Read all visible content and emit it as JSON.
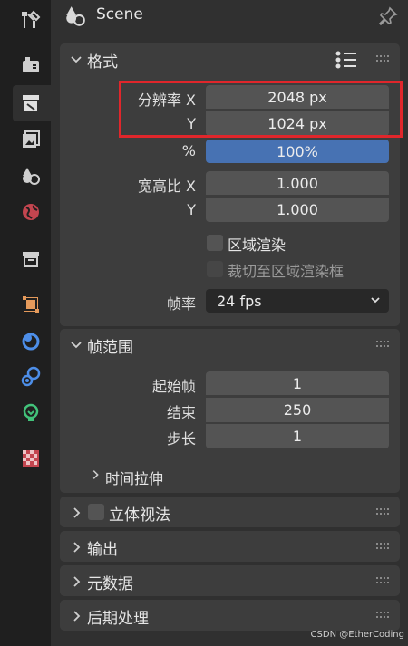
{
  "header": {
    "title": "Scene",
    "icon": "scene-icon",
    "pin_icon": "pin-icon"
  },
  "sidebar": {
    "tabs": [
      {
        "name": "tool-icon"
      },
      {
        "name": "render-icon"
      },
      {
        "name": "output-icon",
        "active": true
      },
      {
        "name": "view-layer-icon"
      },
      {
        "name": "scene-icon"
      },
      {
        "name": "world-icon"
      },
      {
        "name": "collection-icon"
      },
      {
        "name": "object-icon"
      },
      {
        "name": "modifier-icon"
      },
      {
        "name": "physics-icon"
      },
      {
        "name": "object-data-icon"
      },
      {
        "name": "texture-icon"
      }
    ]
  },
  "format_panel": {
    "title": "格式",
    "resolution_x_label": "分辨率 X",
    "resolution_y_label": "Y",
    "resolution_x": "2048 px",
    "resolution_y": "1024 px",
    "percent_label": "%",
    "percent_value": "100%",
    "percent_fraction": 1.0,
    "aspect_x_label": "宽高比 X",
    "aspect_y_label": "Y",
    "aspect_x": "1.000",
    "aspect_y": "1.000",
    "render_region_label": "区域渲染",
    "crop_region_label": "裁切至区域渲染框",
    "frame_rate_label": "帧率",
    "frame_rate_value": "24 fps"
  },
  "frame_range_panel": {
    "title": "帧范围",
    "start_label": "起始帧",
    "start_value": "1",
    "end_label": "结束",
    "end_value": "250",
    "step_label": "步长",
    "step_value": "1",
    "time_stretch_label": "时间拉伸"
  },
  "stereoscopy_panel": {
    "title": "立体视法"
  },
  "output_panel": {
    "title": "输出"
  },
  "metadata_panel": {
    "title": "元数据"
  },
  "post_panel": {
    "title": "后期处理"
  },
  "watermark": "CSDN @EtherCoding",
  "colors": {
    "accent": "#4772b3",
    "highlight": "#e0262b"
  }
}
